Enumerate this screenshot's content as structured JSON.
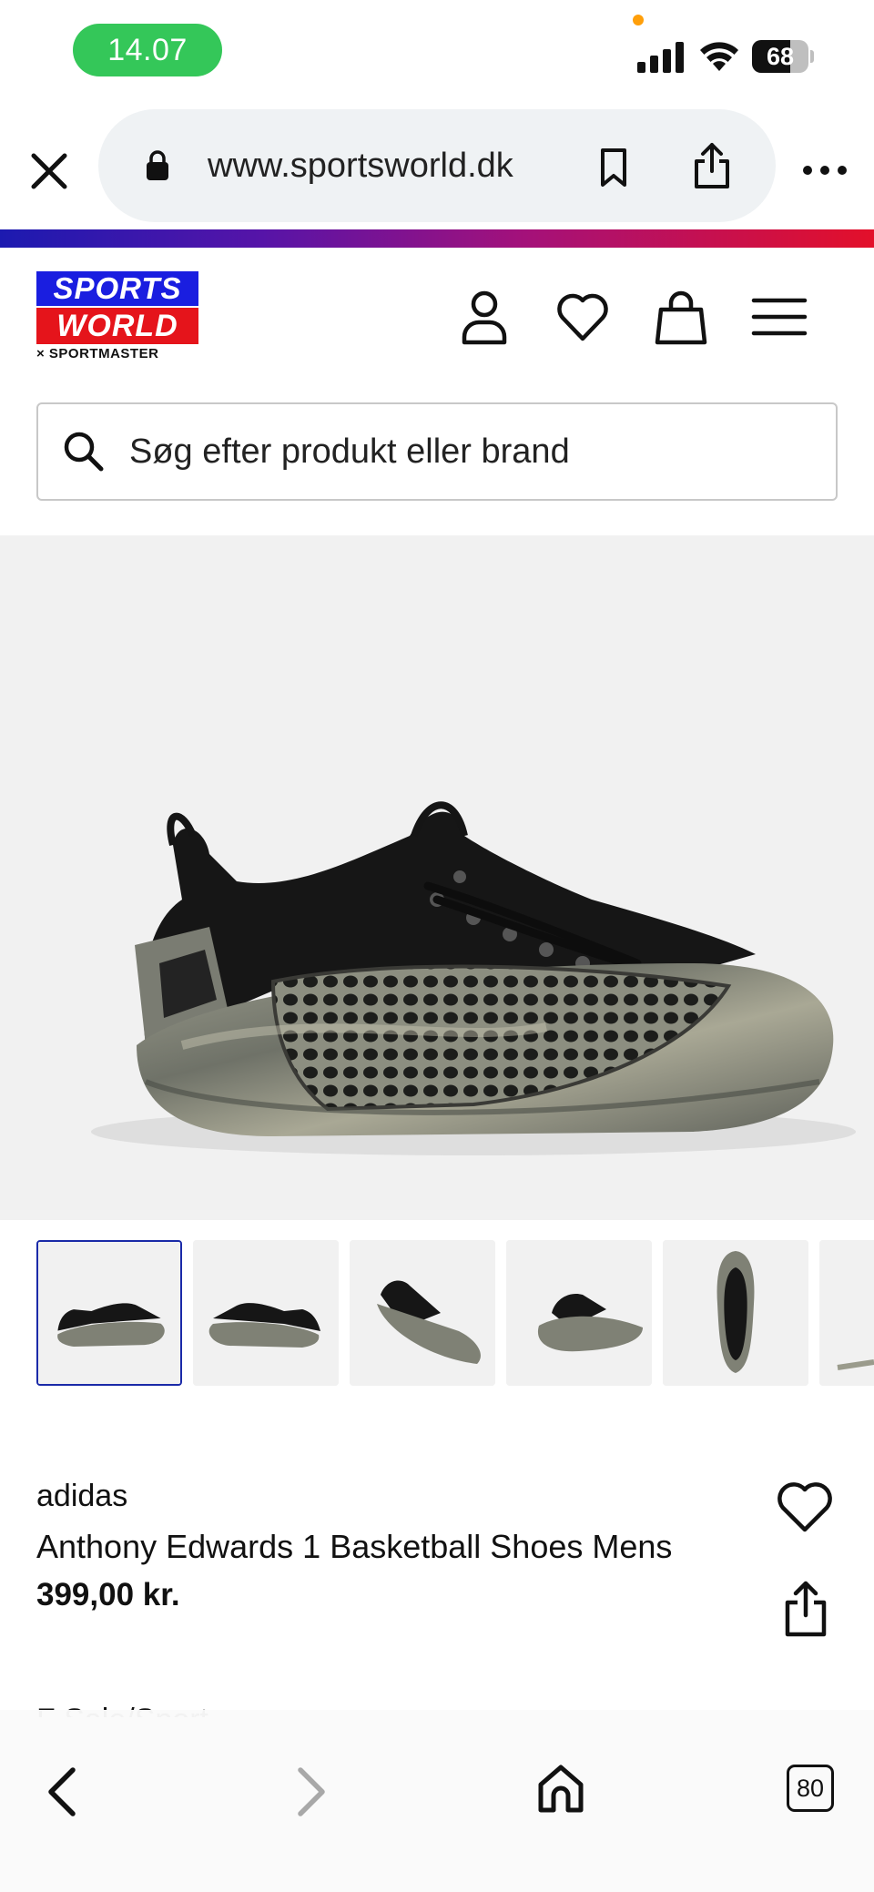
{
  "status_bar": {
    "time": "14.07",
    "battery": "68",
    "battery_level": 0.68,
    "icons": [
      "signal-icon",
      "wifi-icon",
      "battery-icon"
    ]
  },
  "browser": {
    "url": "www.sportsworld.dk",
    "icons": [
      "close-icon",
      "lock-icon",
      "bookmark-icon",
      "share-icon",
      "more-icon"
    ]
  },
  "site": {
    "logo_line1": "SPORTS",
    "logo_line2": "WORLD",
    "logo_sub": "× SPORTMASTER",
    "header_icons": [
      "account-icon",
      "heart-icon",
      "bag-icon",
      "menu-icon"
    ],
    "brand_colors": {
      "blue": "#1a1ee0",
      "red": "#e5141b"
    }
  },
  "search": {
    "placeholder": "Søg efter produkt eller brand"
  },
  "gallery": {
    "thumbnail_count": 6,
    "active_index": 0,
    "active_border_color": "#1a2aa8"
  },
  "product": {
    "brand": "adidas",
    "name": "Anthony Edwards 1 Basketball Shoes Mens",
    "price": "399,00 kr.",
    "partial_line": "F    Sale/Sport"
  },
  "toolbar": {
    "tab_count": "80",
    "icons": [
      "back-icon",
      "forward-icon",
      "home-icon",
      "tabs-icon"
    ]
  }
}
